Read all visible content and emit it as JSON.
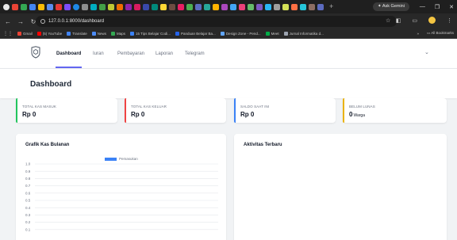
{
  "browser": {
    "ask_gemini": "Ask Gemini",
    "url": "127.0.0.1:8000/dashboard",
    "new_tab": "+",
    "bookmarks": [
      {
        "label": "Gmail",
        "color": "#ea4335"
      },
      {
        "label": "(5) YouTube",
        "color": "#ff0000"
      },
      {
        "label": "Translate",
        "color": "#4285f4"
      },
      {
        "label": "News",
        "color": "#4c8bf5"
      },
      {
        "label": "Maps",
        "color": "#34a853"
      },
      {
        "label": "15 Tips Belajar Codi...",
        "color": "#3b82f6"
      },
      {
        "label": "Panduan Belajar Ba...",
        "color": "#2563eb"
      },
      {
        "label": "Design Zone - Pend...",
        "color": "#60a5fa"
      },
      {
        "label": "Meet",
        "color": "#00ac47"
      },
      {
        "label": "Jurnal Informatika d...",
        "color": "#9ca3af"
      }
    ],
    "all_bookmarks": "All Bookmarks"
  },
  "nav": {
    "items": [
      {
        "label": "Dashboard",
        "active": true
      },
      {
        "label": "Iuran",
        "active": false
      },
      {
        "label": "Pembayaran",
        "active": false
      },
      {
        "label": "Laporan",
        "active": false
      },
      {
        "label": "Telegram",
        "active": false
      }
    ]
  },
  "page": {
    "title": "Dashboard"
  },
  "stats": [
    {
      "label": "TOTAL KAS MASUK",
      "value": "Rp 0",
      "unit": "",
      "color": "#22c55e"
    },
    {
      "label": "TOTAL KAS KELUAR",
      "value": "Rp 0",
      "unit": "",
      "color": "#ef4444"
    },
    {
      "label": "SALDO SAAT INI",
      "value": "Rp 0",
      "unit": "",
      "color": "#3b82f6"
    },
    {
      "label": "BELUM LUNAS",
      "value": "0",
      "unit": "Warga",
      "color": "#eab308"
    }
  ],
  "panels": {
    "chart_title": "Grafik Kas Bulanan",
    "activity_title": "Aktivitas Terbaru"
  },
  "chart_data": {
    "type": "bar",
    "legend": "Pemasukan",
    "series": [
      {
        "name": "Pemasukan",
        "values": []
      }
    ],
    "ylim": [
      0,
      1.0
    ],
    "yticks": [
      "1.0",
      "0.9",
      "0.8",
      "0.7",
      "0.6",
      "0.5",
      "0.4",
      "0.3",
      "0.2",
      "0.1"
    ],
    "grid": true,
    "legend_position": "top",
    "color": "#3b82f6"
  }
}
